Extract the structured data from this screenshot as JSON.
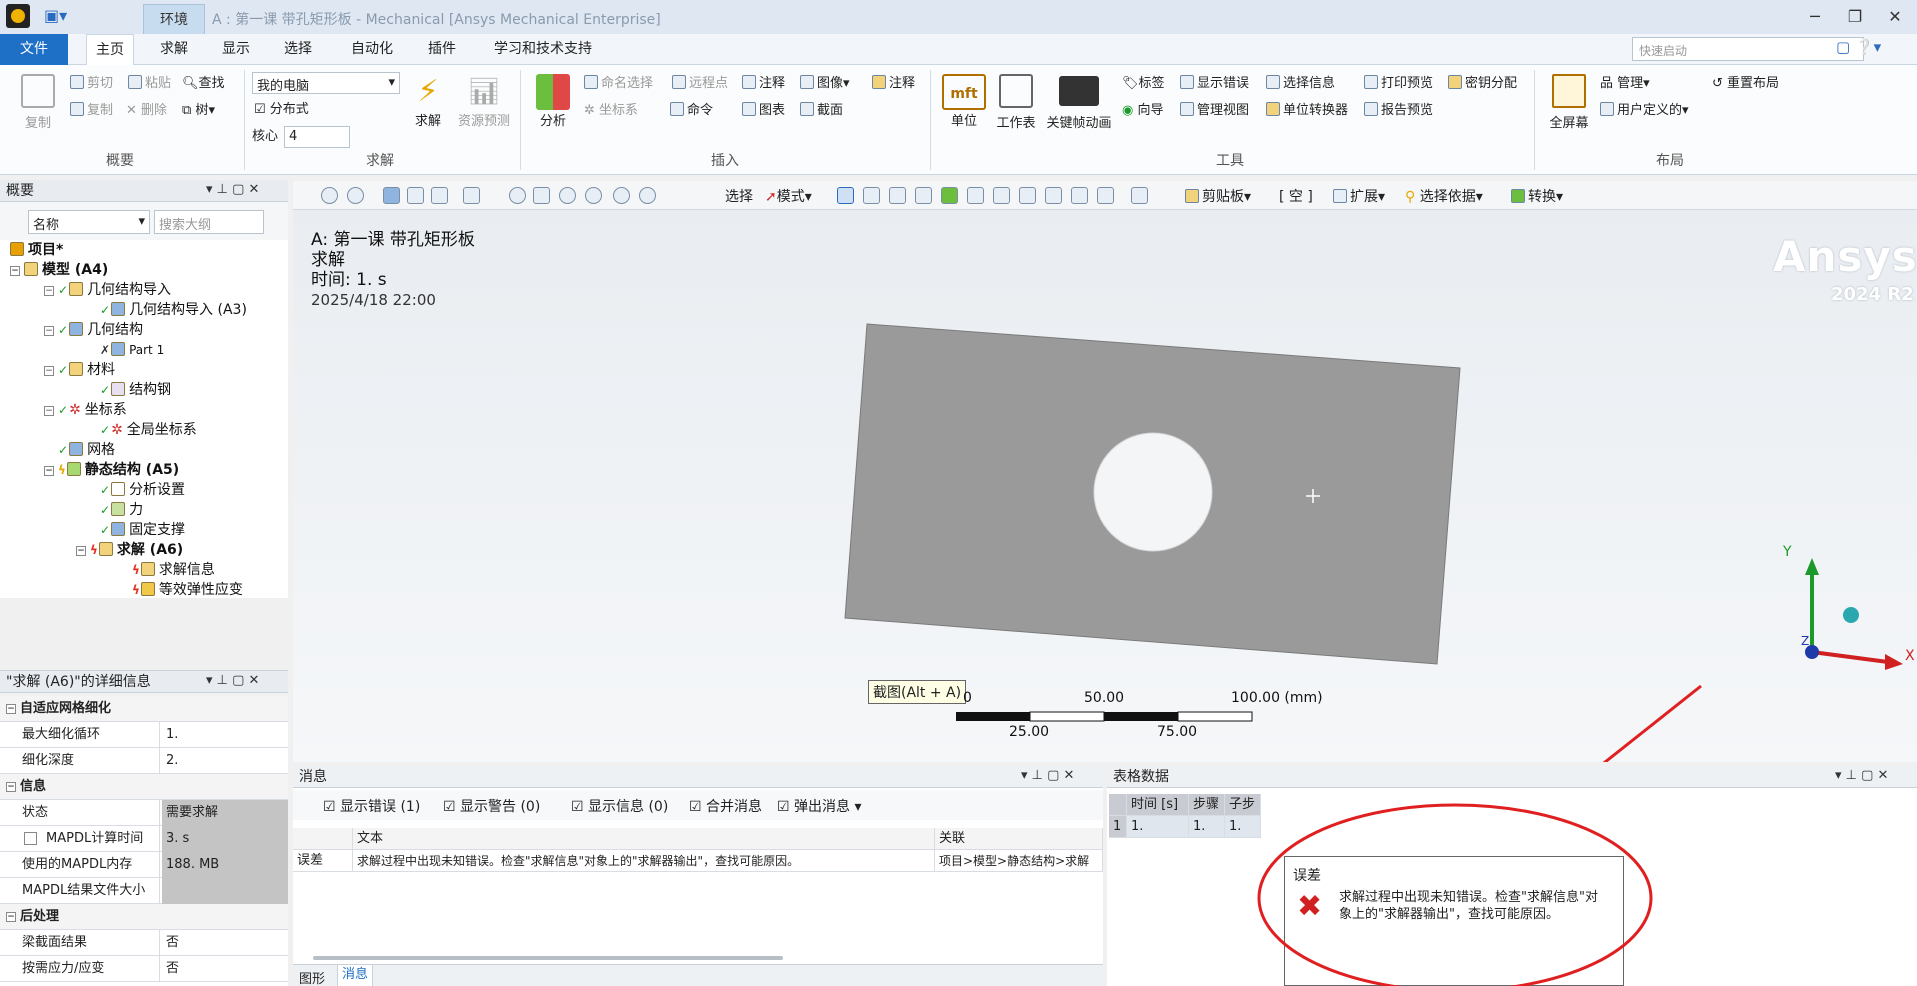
{
  "titlebar": {
    "env_tab": "环境",
    "title": "A : 第一课 带孔矩形板 - Mechanical [Ansys Mechanical Enterprise]",
    "min": "─",
    "restore": "❐",
    "close": "✕"
  },
  "menu": {
    "file": "文件",
    "tabs": [
      "主页",
      "求解",
      "显示",
      "选择",
      "自动化",
      "插件",
      "学习和技术支持"
    ],
    "quick_search_placeholder": "快速启动"
  },
  "ribbon": {
    "outline_group": {
      "label": "概要",
      "copy_big": "复制",
      "cut": "剪切",
      "paste": "粘贴",
      "find": "查找",
      "copy": "复制",
      "delete": "删除",
      "tree": "树"
    },
    "solve_group": {
      "label": "求解",
      "machine": "我的电脑",
      "distributed": "分布式",
      "cores_label": "核心",
      "cores_value": "4",
      "solve": "求解",
      "resource_predict": "资源预测"
    },
    "insert_group": {
      "label": "插入",
      "analysis": "分析",
      "named_selection": "命名选择",
      "remote_point": "远程点",
      "comment": "注释",
      "image": "图像",
      "annotation": "注释",
      "coord_sys": "坐标系",
      "command": "命令",
      "chart": "图表",
      "section": "截面"
    },
    "tools_group": {
      "label": "工具",
      "units": "单位",
      "worksheet": "工作表",
      "key_anim": "关键帧动画",
      "tags": "标签",
      "show_errors": "显示错误",
      "selection_info": "选择信息",
      "print_preview": "打印预览",
      "key_assign": "密钥分配",
      "wizard": "向导",
      "manage_views": "管理视图",
      "unit_converter": "单位转换器",
      "report_preview": "报告预览"
    },
    "layout_group": {
      "label": "布局",
      "fullscreen": "全屏幕",
      "manage": "管理",
      "user_defined": "用户定义的",
      "reset_layout": "重置布局"
    }
  },
  "outline": {
    "title": "概要",
    "name_filter": "名称",
    "search_placeholder": "搜索大纲",
    "nodes": [
      {
        "label": "项目*",
        "bold": true
      },
      {
        "label": "模型 (A4)",
        "bold": true
      },
      {
        "label": "几何结构导入"
      },
      {
        "label": "几何结构导入 (A3)"
      },
      {
        "label": "几何结构"
      },
      {
        "label": "Part 1"
      },
      {
        "label": "材料"
      },
      {
        "label": "结构钢"
      },
      {
        "label": "坐标系"
      },
      {
        "label": "全局坐标系"
      },
      {
        "label": "网格"
      },
      {
        "label": "静态结构 (A5)",
        "bold": true
      },
      {
        "label": "分析设置"
      },
      {
        "label": "力"
      },
      {
        "label": "固定支撑"
      },
      {
        "label": "求解 (A6)",
        "bold": true
      },
      {
        "label": "求解信息"
      },
      {
        "label": "等效弹性应变"
      }
    ]
  },
  "details": {
    "title": "\"求解 (A6)\"的详细信息",
    "sections": [
      {
        "name": "自适应网格细化",
        "rows": [
          {
            "k": "最大细化循环",
            "v": "1."
          },
          {
            "k": "细化深度",
            "v": "2."
          }
        ]
      },
      {
        "name": "信息",
        "rows": [
          {
            "k": "状态",
            "v": "需要求解"
          },
          {
            "k": "MAPDL计算时间",
            "v": "3. s"
          },
          {
            "k": "使用的MAPDL内存",
            "v": "188. MB"
          },
          {
            "k": "MAPDL结果文件大小",
            "v": ""
          }
        ]
      },
      {
        "name": "后处理",
        "rows": [
          {
            "k": "梁截面结果",
            "v": "否"
          },
          {
            "k": "按需应力/应变",
            "v": "否"
          }
        ]
      }
    ]
  },
  "graphics_toolbar": {
    "select": "选择",
    "mode": "模式",
    "clipboard": "剪贴板",
    "empty": "[ 空 ]",
    "extend": "扩展",
    "select_by": "选择依据",
    "convert": "转换"
  },
  "viewport": {
    "header_line1": "A: 第一课 带孔矩形板",
    "header_line2": "求解",
    "header_line3": "时间: 1. s",
    "header_line4": "2025/4/18 22:00",
    "brand": "Ansys",
    "version": "2024 R2",
    "tooltip": "截图(Alt + A)",
    "scale_0": "0",
    "scale_50": "50.00",
    "scale_100": "100.00 (mm)",
    "scale_25": "25.00",
    "scale_75": "75.00",
    "axis_y": "Y",
    "axis_x": "X",
    "axis_z": "Z"
  },
  "messages": {
    "title": "消息",
    "filters": [
      {
        "label": "显示错误",
        "count": "(1)"
      },
      {
        "label": "显示警告",
        "count": "(0)"
      },
      {
        "label": "显示信息",
        "count": "(0)"
      },
      {
        "label": "合并消息",
        "count": ""
      },
      {
        "label": "弹出消息",
        "count": ""
      }
    ],
    "col_text": "文本",
    "col_assoc": "关联",
    "row_type": "误差",
    "row_text": "求解过程中出现未知错误。检查\"求解信息\"对象上的\"求解器输出\"，查找可能原因。",
    "row_assoc": "项目>模型>静态结构>求解",
    "tab_graphics": "图形",
    "tab_messages": "消息"
  },
  "tabular": {
    "title": "表格数据",
    "cols": [
      "时间 [s]",
      "步骤",
      "子步"
    ],
    "row_index": "1",
    "row": [
      "1.",
      "1.",
      "1."
    ]
  },
  "popup": {
    "title": "误差",
    "text": "求解过程中出现未知错误。检查\"求解信息\"对象上的\"求解器输出\"，查找可能原因。"
  },
  "colors": {
    "accent": "#1e6fc6",
    "plate": "#9a9a9a",
    "annotation": "#e02020"
  }
}
